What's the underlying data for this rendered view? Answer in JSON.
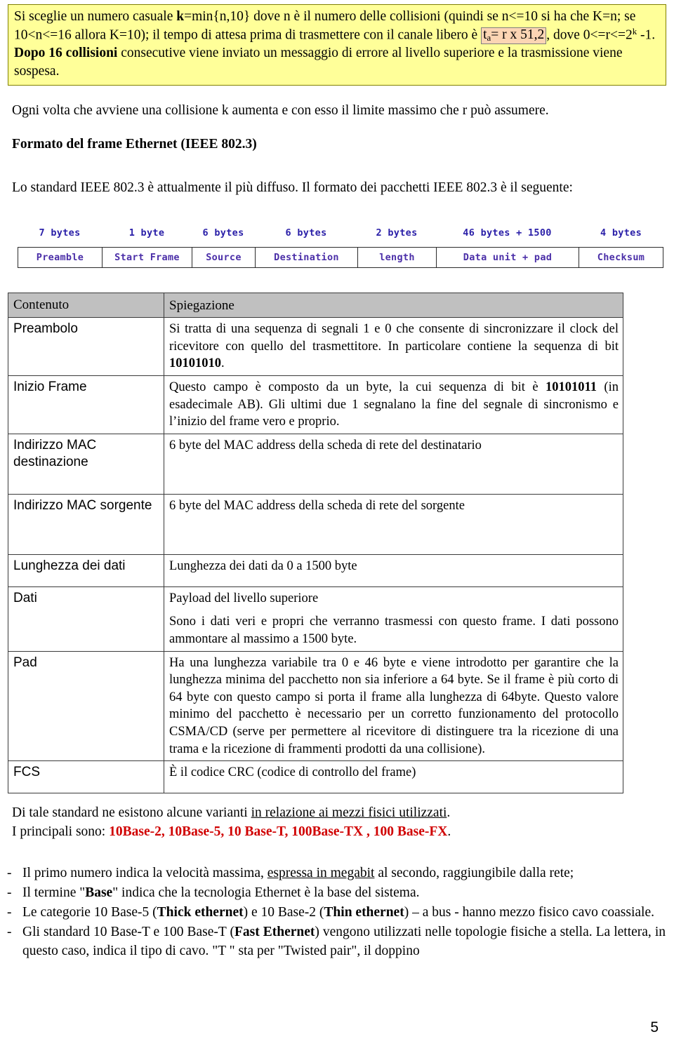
{
  "callout": {
    "line1_a": "Si sceglie un numero casuale ",
    "line1_k": "k",
    "line1_b": "=min{n,10} dove n è il numero delle collisioni (quindi se n<=10 si ha che K=n; se 10<n<=16 allora K=10); il tempo di attesa prima di trasmettere con il canale libero è ",
    "formula_t": "t",
    "formula_sub": "a",
    "formula_rest": "= r x 51,2",
    "after_formula": ", dove 0<=r<=2",
    "exp_k": "k",
    "after_exp": " -1. ",
    "bold_dopo": "Dopo 16 collisioni",
    "tail": " consecutive viene inviato un messaggio di errore al livello superiore e la trasmissione viene sospesa."
  },
  "body": {
    "para_ogni": "Ogni volta che avviene una collisione k aumenta e con esso il limite massimo che r può assumere.",
    "heading_formato": "Formato del frame Ethernet (IEEE 802.3)",
    "para_standard": "Lo standard IEEE 802.3 è attualmente il più diffuso. Il formato dei pacchetti IEEE 802.3 è il seguente:"
  },
  "frame_diagram": {
    "fields": [
      {
        "size": "7 bytes",
        "name": "Preamble"
      },
      {
        "size": "1 byte",
        "name": "Start Frame"
      },
      {
        "size": "6 bytes",
        "name": "Source"
      },
      {
        "size": "6 bytes",
        "name": "Destination"
      },
      {
        "size": "2 bytes",
        "name": "length"
      },
      {
        "size": "46 bytes + 1500",
        "name": "Data unit + pad"
      },
      {
        "size": "4 bytes",
        "name": "Checksum"
      }
    ]
  },
  "table": {
    "headers": {
      "col1": "Contenuto",
      "col2": "Spiegazione"
    },
    "rows": [
      {
        "term": "Preambolo",
        "expl_pre": "Si tratta di una sequenza di segnali 1 e 0 che consente di sincronizzare il clock del ricevitore con quello del trasmettitore. In particolare contiene la sequenza di bit ",
        "expl_bold": "10101010",
        "expl_post": "."
      },
      {
        "term": "Inizio Frame",
        "expl_pre": "Questo campo è composto da un byte, la cui sequenza di bit è ",
        "expl_bold": "10101011",
        "expl_post": " (in esadecimale AB). Gli ultimi due 1 segnalano la fine del segnale di sincronismo e l’inizio del frame vero e proprio."
      },
      {
        "term": "Indirizzo MAC destinazione",
        "expl_pre": "6 byte del MAC address della scheda di rete del destinatario",
        "expl_bold": "",
        "expl_post": ""
      },
      {
        "term": "Indirizzo MAC sorgente",
        "expl_pre": "6 byte del MAC address della scheda di rete del sorgente",
        "expl_bold": "",
        "expl_post": ""
      },
      {
        "term": "Lunghezza dei dati",
        "expl_pre": "Lunghezza dei dati da 0 a 1500 byte",
        "expl_bold": "",
        "expl_post": ""
      },
      {
        "term": "Dati",
        "expl_pre": "Payload del livello superiore",
        "expl_bold": "",
        "expl_post": "",
        "expl_second": "Sono i dati veri e propri che verranno trasmessi con questo frame. I dati possono ammontare al massimo a 1500 byte."
      },
      {
        "term": "Pad",
        "expl_pre": "Ha una lunghezza variabile tra 0 e 46 byte e viene introdotto per garantire che la lunghezza minima del pacchetto non sia inferiore a 64 byte. Se il frame è più corto di 64 byte con questo campo si porta il frame alla lunghezza di 64byte. Questo valore minimo del pacchetto è necessario per un corretto funzionamento del protocollo CSMA/CD (serve per permettere al ricevitore di distinguere tra la ricezione di una trama e la ricezione di frammenti prodotti da una collisione).",
        "expl_bold": "",
        "expl_post": ""
      },
      {
        "term": "FCS",
        "expl_pre": "È il codice CRC (codice di controllo del frame)",
        "expl_bold": "",
        "expl_post": ""
      }
    ]
  },
  "closing": {
    "line1_a": "Di tale standard ne esistono alcune varianti ",
    "line1_underline": "in relazione ai mezzi fisici utilizzati",
    "line1_b": ".",
    "line2_a": "I principali sono: ",
    "line2_red": "10Base-2, 10Base-5, 10 Base-T, 100Base-TX , 100 Base-FX",
    "line2_b": "."
  },
  "bullets": [
    {
      "dash": "-",
      "pre": "Il primo numero indica la velocità massima, ",
      "underline": "espressa in megabit",
      "post": " al secondo, raggiungibile dalla rete;"
    },
    {
      "dash": "-",
      "pre": "Il termine \"",
      "bold": "Base",
      "post": "\" indica che la tecnologia Ethernet è la base del sistema."
    },
    {
      "dash": "-",
      "pre": "Le categorie 10 Base-5 (",
      "bold": "Thick  ethernet",
      "mid": ") e 10 Base-2 (",
      "bold2": "Thin  ethernet",
      "post": ") – a bus -  hanno mezzo fisico cavo coassiale."
    },
    {
      "dash": "-",
      "pre": "Gli standard 10 Base-T e 100 Base-T (",
      "bold": "Fast Ethernet",
      "post": ") vengono utilizzati nelle topologie fisiche a stella. La lettera, in questo caso, indica il tipo di cavo. \"T \" sta per \"Twisted pair\", il doppino"
    }
  ],
  "footer": {
    "page_number": "5"
  }
}
